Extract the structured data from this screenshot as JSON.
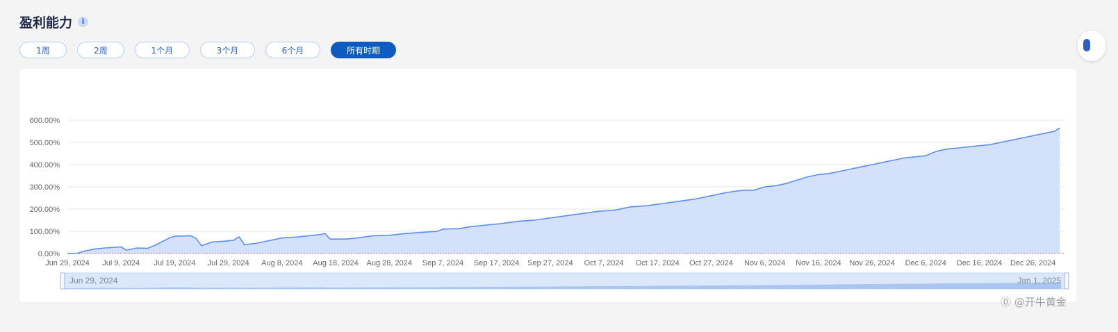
{
  "header": {
    "title": "盈利能力",
    "info_glyph": "i"
  },
  "tabs": [
    {
      "label": "1周",
      "active": false
    },
    {
      "label": "2周",
      "active": false
    },
    {
      "label": "1个月",
      "active": false
    },
    {
      "label": "3个月",
      "active": false
    },
    {
      "label": "6个月",
      "active": false
    },
    {
      "label": "所有时期",
      "active": true
    }
  ],
  "watermark": "⓪ @开牛黄金",
  "colors": {
    "line": "#5b8def",
    "area": "#d3e1fb",
    "zero_line": "#e06666",
    "grid": "#e6e6e6",
    "accent": "#0f5cc0"
  },
  "chart_data": {
    "type": "area",
    "x_start": "2024-06-29",
    "x_end": "2025-01-01",
    "xticks": [
      "Jun 29, 2024",
      "Jul 9, 2024",
      "Jul 19, 2024",
      "Jul 29, 2024",
      "Aug 8, 2024",
      "Aug 18, 2024",
      "Aug 28, 2024",
      "Sep 7, 2024",
      "Sep 17, 2024",
      "Sep 27, 2024",
      "Oct 7, 2024",
      "Oct 17, 2024",
      "Oct 27, 2024",
      "Nov 6, 2024",
      "Nov 16, 2024",
      "Nov 26, 2024",
      "Dec 6, 2024",
      "Dec 16, 2024",
      "Dec 26, 2024"
    ],
    "yticks": [
      "0.00%",
      "100.00%",
      "200.00%",
      "300.00%",
      "400.00%",
      "500.00%",
      "600.00%"
    ],
    "ylim": [
      0,
      600
    ],
    "grid": true,
    "slider": {
      "start_label": "Jun 29, 2024",
      "end_label": "Jan 1, 2025"
    },
    "series": [
      {
        "x": [
          "2024-06-29",
          "2024-07-01",
          "2024-07-02",
          "2024-07-04",
          "2024-07-06",
          "2024-07-08",
          "2024-07-09",
          "2024-07-10",
          "2024-07-11",
          "2024-07-12",
          "2024-07-14",
          "2024-07-16",
          "2024-07-18",
          "2024-07-19",
          "2024-07-22",
          "2024-07-23",
          "2024-07-24",
          "2024-07-26",
          "2024-07-28",
          "2024-07-30",
          "2024-07-31",
          "2024-08-01",
          "2024-08-03",
          "2024-08-05",
          "2024-08-08",
          "2024-08-11",
          "2024-08-13",
          "2024-08-15",
          "2024-08-16",
          "2024-08-17",
          "2024-08-20",
          "2024-08-22",
          "2024-08-25",
          "2024-08-28",
          "2024-08-31",
          "2024-09-03",
          "2024-09-06",
          "2024-09-07",
          "2024-09-10",
          "2024-09-12",
          "2024-09-15",
          "2024-09-18",
          "2024-09-21",
          "2024-09-24",
          "2024-09-27",
          "2024-09-30",
          "2024-10-03",
          "2024-10-06",
          "2024-10-09",
          "2024-10-12",
          "2024-10-15",
          "2024-10-18",
          "2024-10-21",
          "2024-10-24",
          "2024-10-27",
          "2024-10-30",
          "2024-11-02",
          "2024-11-04",
          "2024-11-06",
          "2024-11-08",
          "2024-11-10",
          "2024-11-12",
          "2024-11-14",
          "2024-11-16",
          "2024-11-18",
          "2024-11-20",
          "2024-11-22",
          "2024-11-24",
          "2024-11-26",
          "2024-11-28",
          "2024-11-30",
          "2024-12-02",
          "2024-12-04",
          "2024-12-06",
          "2024-12-08",
          "2024-12-10",
          "2024-12-12",
          "2024-12-14",
          "2024-12-16",
          "2024-12-18",
          "2024-12-20",
          "2024-12-22",
          "2024-12-24",
          "2024-12-26",
          "2024-12-28",
          "2024-12-30",
          "2024-12-31"
        ],
        "y": [
          0,
          2,
          10,
          20,
          25,
          28,
          30,
          15,
          20,
          25,
          23,
          45,
          70,
          78,
          80,
          68,
          35,
          52,
          55,
          60,
          75,
          40,
          45,
          55,
          70,
          75,
          80,
          85,
          90,
          65,
          65,
          70,
          80,
          82,
          90,
          95,
          100,
          110,
          112,
          120,
          128,
          135,
          145,
          150,
          160,
          170,
          180,
          190,
          195,
          210,
          215,
          225,
          235,
          245,
          260,
          275,
          285,
          285,
          300,
          305,
          315,
          330,
          345,
          355,
          360,
          370,
          380,
          390,
          400,
          410,
          420,
          430,
          435,
          440,
          460,
          470,
          475,
          480,
          485,
          490,
          500,
          510,
          520,
          530,
          540,
          550,
          565
        ]
      }
    ]
  }
}
